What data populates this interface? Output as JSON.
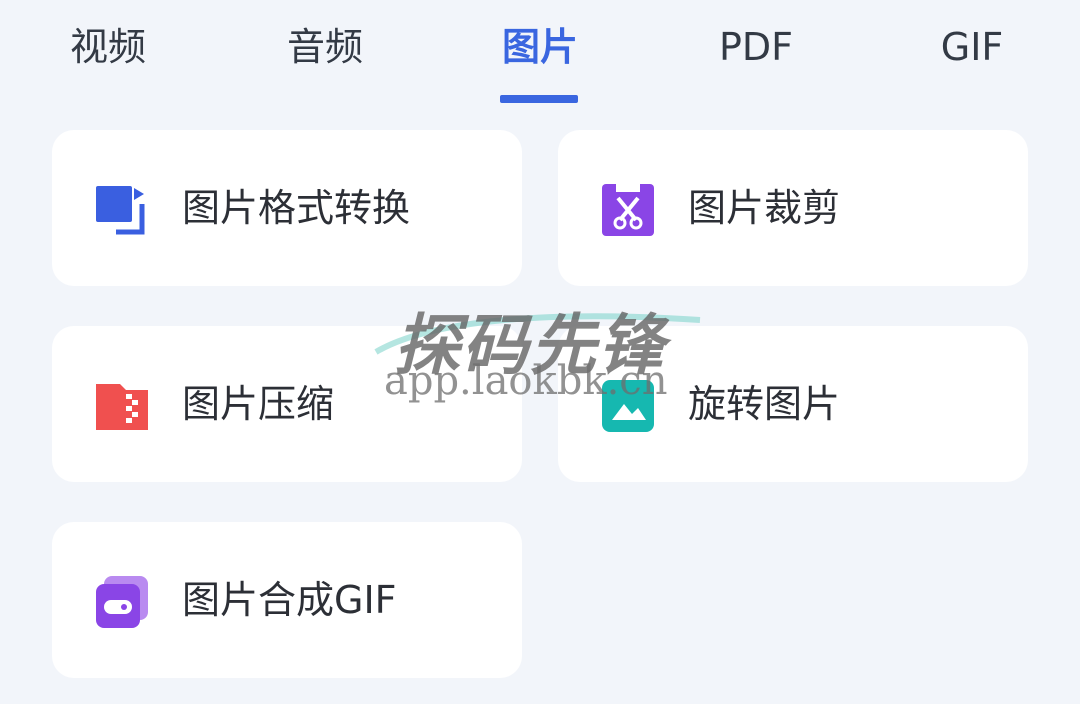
{
  "tabs": [
    {
      "label": "视频",
      "active": false
    },
    {
      "label": "音频",
      "active": false
    },
    {
      "label": "图片",
      "active": true
    },
    {
      "label": "PDF",
      "active": false
    },
    {
      "label": "GIF",
      "active": false
    }
  ],
  "cards": [
    {
      "label": "图片格式转换",
      "icon": "image-format-convert-icon",
      "color": "#3a5fe0"
    },
    {
      "label": "图片裁剪",
      "icon": "image-crop-scissors-icon",
      "color": "#8a45e6"
    },
    {
      "label": "图片压缩",
      "icon": "image-compress-zip-icon",
      "color": "#f0504f"
    },
    {
      "label": "旋转图片",
      "icon": "image-rotate-landscape-icon",
      "color": "#16b8b0"
    },
    {
      "label": "图片合成GIF",
      "icon": "image-to-gif-icon",
      "color": "#8a45e6"
    }
  ],
  "watermark": {
    "title": "探码先锋",
    "url": "app.laokbk.cn"
  },
  "colors": {
    "accent": "#3a66e0",
    "background": "#f2f5fa",
    "card": "#ffffff"
  }
}
